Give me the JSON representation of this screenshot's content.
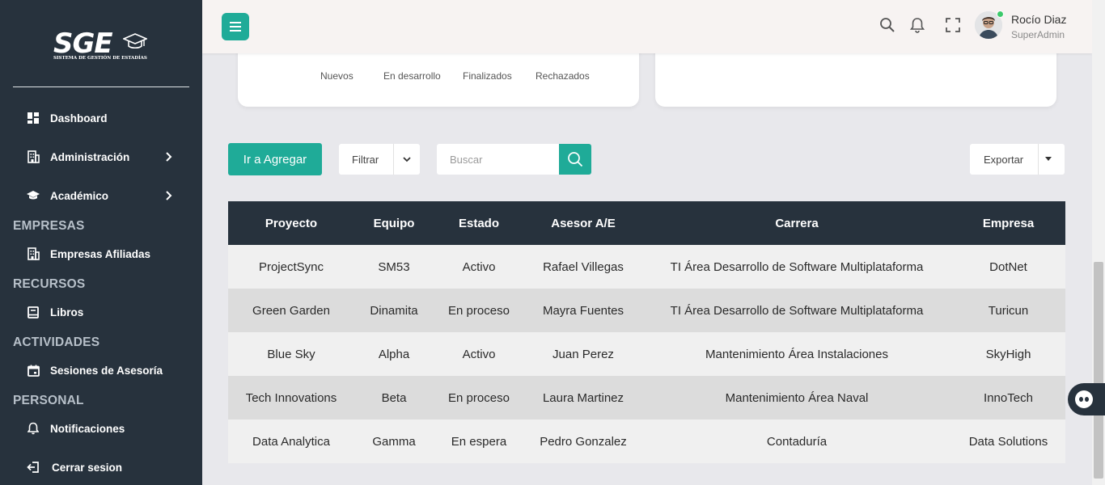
{
  "app": {
    "logo_text": "SGE",
    "logo_subtitle": "SISTEMA DE GESTIÓN DE ESTADÍAS"
  },
  "sidebar": {
    "items": [
      {
        "label": "Dashboard",
        "icon": "grid-icon"
      },
      {
        "label": "Administración",
        "icon": "building-icon",
        "has_submenu": true
      },
      {
        "label": "Académico",
        "icon": "graduation-cap-icon",
        "has_submenu": true
      },
      {
        "label": "Empresas Afiliadas",
        "icon": "building-icon"
      },
      {
        "label": "Libros",
        "icon": "book-icon"
      },
      {
        "label": "Sesiones de Asesoría",
        "icon": "calendar-icon"
      },
      {
        "label": "Notificaciones",
        "icon": "bell-icon"
      },
      {
        "label": "Cerrar sesion",
        "icon": "logout-icon"
      }
    ],
    "sections": [
      "EMPRESAS",
      "RECURSOS",
      "ACTIVIDADES",
      "PERSONAL"
    ]
  },
  "header": {
    "user_name": "Rocío Diaz",
    "user_role": "SuperAdmin"
  },
  "stats_card": {
    "labels": [
      "Nuevos",
      "En desarrollo",
      "Finalizados",
      "Rechazados"
    ]
  },
  "toolbar": {
    "add_label": "Ir a Agregar",
    "filter_label": "Filtrar",
    "search_placeholder": "Buscar",
    "export_label": "Exportar"
  },
  "table": {
    "columns": [
      "Proyecto",
      "Equipo",
      "Estado",
      "Asesor A/E",
      "Carrera",
      "Empresa"
    ],
    "rows": [
      [
        "ProjectSync",
        "SM53",
        "Activo",
        "Rafael Villegas",
        "TI Área Desarrollo de Software Multiplataforma",
        "DotNet"
      ],
      [
        "Green Garden",
        "Dinamita",
        "En proceso",
        "Mayra Fuentes",
        "TI Área Desarrollo de Software Multiplataforma",
        "Turicun"
      ],
      [
        "Blue Sky",
        "Alpha",
        "Activo",
        "Juan Perez",
        "Mantenimiento Área Instalaciones",
        "SkyHigh"
      ],
      [
        "Tech Innovations",
        "Beta",
        "En proceso",
        "Laura Martinez",
        "Mantenimiento Área Naval",
        "InnoTech"
      ],
      [
        "Data Analytica",
        "Gamma",
        "En espera",
        "Pedro Gonzalez",
        "Contaduría",
        "Data Solutions"
      ]
    ]
  },
  "colors": {
    "accent": "#1fab98",
    "sidebar_bg": "#27323d",
    "online": "#3cc96b"
  }
}
